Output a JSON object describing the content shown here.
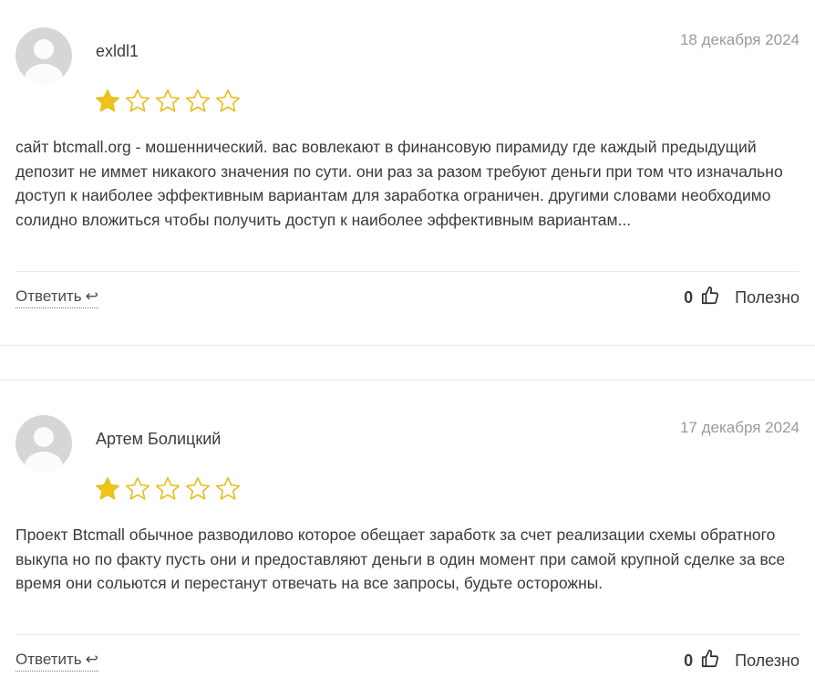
{
  "colors": {
    "star_filled": "#F0C419",
    "star_empty_stroke": "#E8BE1E",
    "avatar_bg": "#D6D6D6"
  },
  "reviews": [
    {
      "author": "exldl1",
      "date": "18 декабря 2024",
      "rating": 1,
      "max_rating": 5,
      "text": "сайт btcmall.org - мошеннический. вас вовлекают в финансовую пирамиду где каждый предыдущий депозит не иммет никакого значения по сути. они раз за разом требуют деньги при том что изначально доступ к наиболее эффективным вариантам для заработка ограничен. другими словами необходимо солидно вложиться чтобы получить доступ к наиболее эффективным вариантам...",
      "reply_label": "Ответить",
      "reply_icon": "reply-arrow-icon",
      "useful_count": "0",
      "useful_label": "Полезно"
    },
    {
      "author": "Артем Болицкий",
      "date": "17 декабря 2024",
      "rating": 1,
      "max_rating": 5,
      "text": "Проект Btcmall обычное разводилово которое обещает заработк за счет реализации схемы обратного выкупа но по факту пусть они и предоставляют деньги в один момент при самой крупной сделке за все время они сольются и перестанут отвечать на все запросы, будьте осторожны.",
      "reply_label": "Ответить",
      "reply_icon": "reply-arrow-icon",
      "useful_count": "0",
      "useful_label": "Полезно"
    }
  ]
}
